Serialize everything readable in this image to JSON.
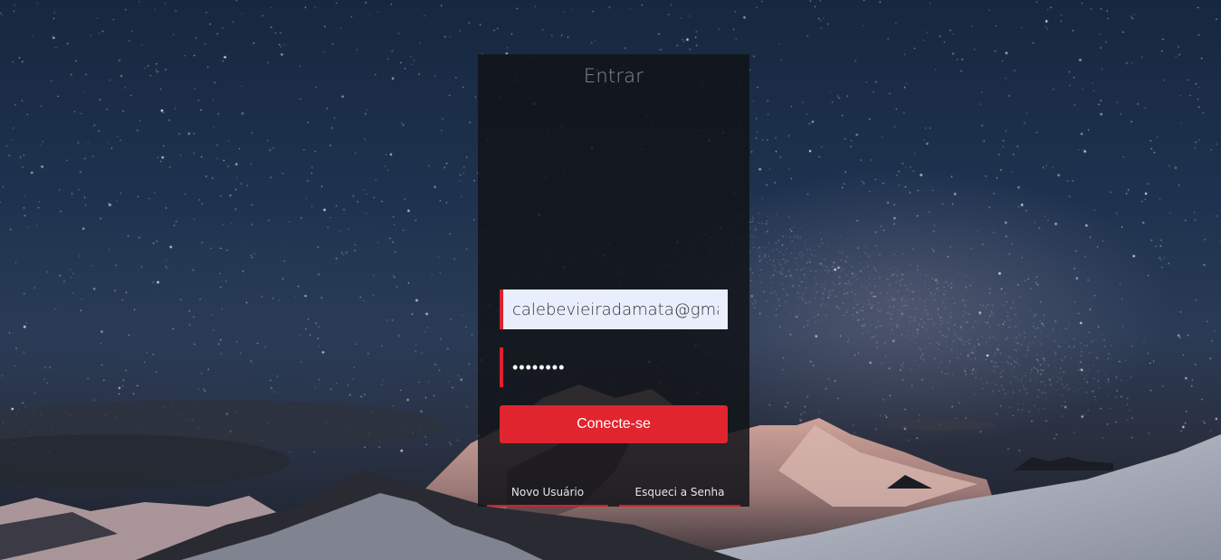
{
  "login": {
    "title": "Entrar",
    "email_value": "calebevieiradamata@gmail.com",
    "password_value": "••••••••",
    "submit_label": "Conecte-se",
    "new_user_label": "Novo Usuário",
    "forgot_password_label": "Esqueci a Senha"
  },
  "colors": {
    "accent": "#e0252f",
    "panel_bg": "#121418",
    "email_field_bg": "#e8eefb"
  }
}
